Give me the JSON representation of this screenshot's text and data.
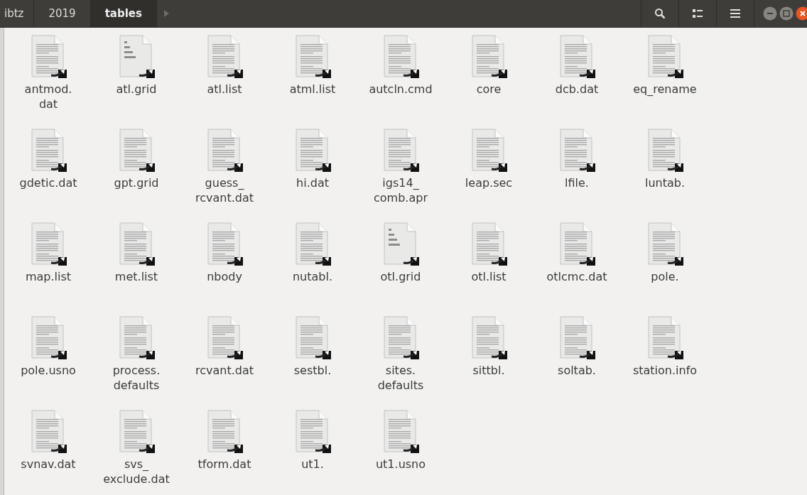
{
  "path_bar": [
    {
      "label": "ibtz",
      "selected": false
    },
    {
      "label": "2019",
      "selected": false
    },
    {
      "label": "tables",
      "selected": true
    }
  ],
  "files": [
    {
      "name": "antmod.\ndat",
      "kind": "text"
    },
    {
      "name": "atl.grid",
      "kind": "binary"
    },
    {
      "name": "atl.list",
      "kind": "text"
    },
    {
      "name": "atml.list",
      "kind": "text"
    },
    {
      "name": "autcln.cmd",
      "kind": "text"
    },
    {
      "name": "core",
      "kind": "text"
    },
    {
      "name": "dcb.dat",
      "kind": "text"
    },
    {
      "name": "eq_rename",
      "kind": "text"
    },
    {
      "name": "gdetic.dat",
      "kind": "text"
    },
    {
      "name": "gpt.grid",
      "kind": "text"
    },
    {
      "name": "guess_\nrcvant.dat",
      "kind": "text"
    },
    {
      "name": "hi.dat",
      "kind": "text"
    },
    {
      "name": "igs14_\ncomb.apr",
      "kind": "text"
    },
    {
      "name": "leap.sec",
      "kind": "text"
    },
    {
      "name": "lfile.",
      "kind": "text"
    },
    {
      "name": "luntab.",
      "kind": "text"
    },
    {
      "name": "map.list",
      "kind": "text"
    },
    {
      "name": "met.list",
      "kind": "text"
    },
    {
      "name": "nbody",
      "kind": "text"
    },
    {
      "name": "nutabl.",
      "kind": "text"
    },
    {
      "name": "otl.grid",
      "kind": "binary"
    },
    {
      "name": "otl.list",
      "kind": "text"
    },
    {
      "name": "otlcmc.dat",
      "kind": "text"
    },
    {
      "name": "pole.",
      "kind": "text"
    },
    {
      "name": "pole.usno",
      "kind": "text"
    },
    {
      "name": "process.\ndefaults",
      "kind": "text"
    },
    {
      "name": "rcvant.dat",
      "kind": "text"
    },
    {
      "name": "sestbl.",
      "kind": "text"
    },
    {
      "name": "sites.\ndefaults",
      "kind": "text"
    },
    {
      "name": "sittbl.",
      "kind": "text"
    },
    {
      "name": "soltab.",
      "kind": "text"
    },
    {
      "name": "station.info",
      "kind": "text"
    },
    {
      "name": "svnav.dat",
      "kind": "text"
    },
    {
      "name": "svs_\nexclude.dat",
      "kind": "text"
    },
    {
      "name": "tform.dat",
      "kind": "text"
    },
    {
      "name": "ut1.",
      "kind": "text"
    },
    {
      "name": "ut1.usno",
      "kind": "text"
    }
  ]
}
